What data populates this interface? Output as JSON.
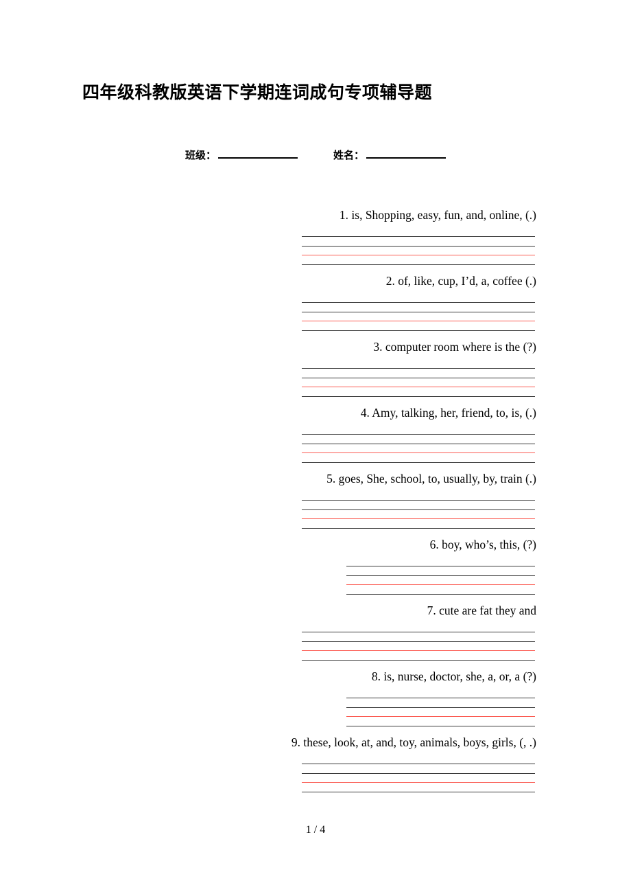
{
  "document": {
    "title": "四年级科教版英语下学期连词成句专项辅导题",
    "footer": "1 / 4"
  },
  "info_row": {
    "class_label": "班级：",
    "name_label": "姓名："
  },
  "questions": [
    {
      "id": "q1",
      "text": "1. is, Shopping, easy, fun, and, online, (.)",
      "lines_span": "wide"
    },
    {
      "id": "q2",
      "text": "2. of,  like, cup, I’d, a, coffee (.)",
      "lines_span": "wide"
    },
    {
      "id": "q3",
      "text": "3. computer  room  where  is  the (?)",
      "lines_span": "wide"
    },
    {
      "id": "q4",
      "text": "4. Amy, talking, her, friend, to, is, (.)",
      "lines_span": "wide"
    },
    {
      "id": "q5",
      "text": "5. goes, She, school, to, usually, by, train (.)",
      "lines_span": "wide"
    },
    {
      "id": "q6",
      "text": "6. boy, who’s, this, (?)",
      "lines_span": "short"
    },
    {
      "id": "q7",
      "text": "7. cute are fat they and",
      "lines_span": "wide"
    },
    {
      "id": "q8",
      "text": "8. is, nurse, doctor, she, a, or, a (?)",
      "lines_span": "short"
    },
    {
      "id": "q9",
      "text": "9. these, look, at, and, toy, animals, boys, girls, (, .)",
      "lines_span": "wide"
    }
  ],
  "colors": {
    "rule_black": "#3a3a3a",
    "rule_red": "#fb5b52",
    "text": "#000000",
    "page_background": "#ffffff"
  }
}
